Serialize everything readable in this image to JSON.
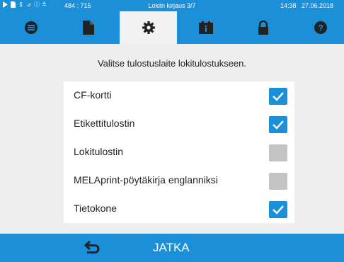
{
  "status_bar": {
    "coords": "484 : 715",
    "title": "Lokiin kirjaus 3/7",
    "time": "14:38",
    "date": "27.06.2018",
    "icons": [
      "play-icon",
      "doc-small-icon",
      "steam-icon",
      "chart-icon",
      "info-circle-icon",
      "lock-small-icon"
    ]
  },
  "tabs": [
    {
      "name": "menu",
      "icon": "menu-list-icon",
      "active": false
    },
    {
      "name": "document",
      "icon": "document-icon",
      "active": false
    },
    {
      "name": "settings",
      "icon": "gear-icon",
      "active": true
    },
    {
      "name": "info",
      "icon": "info-card-icon",
      "active": false
    },
    {
      "name": "lock",
      "icon": "lock-icon",
      "active": false
    },
    {
      "name": "help",
      "icon": "help-icon",
      "active": false
    }
  ],
  "main": {
    "prompt": "Valitse tulostuslaite lokitulostukseen.",
    "options": [
      {
        "label": "CF-kortti",
        "checked": true
      },
      {
        "label": "Etikettitulostin",
        "checked": true
      },
      {
        "label": "Lokitulostin",
        "checked": false
      },
      {
        "label": "MELAprint-pöytäkirja englanniksi",
        "checked": false
      },
      {
        "label": "Tietokone",
        "checked": true
      }
    ]
  },
  "footer": {
    "continue_label": "JATKA",
    "back_icon": "back-arrow-icon"
  },
  "colors": {
    "accent": "#1c8fd9",
    "active_tab": "#f2f2f2",
    "background": "#eeeeee",
    "checkbox_off": "#c4c4c4"
  }
}
